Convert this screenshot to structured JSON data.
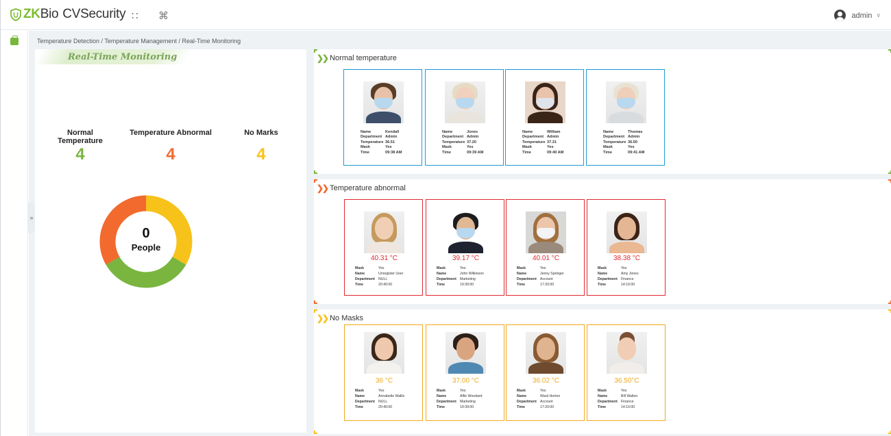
{
  "app": {
    "logo_zk": "ZK",
    "logo_bio": "Bio",
    "logo_product": "CVSecurity",
    "user": "admin",
    "grid_icon": "apps-grid-icon",
    "command_icon": "command-icon"
  },
  "breadcrumb": "Temperature Detection / Temperature Management / Real-Time Monitoring",
  "left": {
    "title": "Real-Time Monitoring",
    "stats": [
      {
        "label": "Normal Temperature",
        "value": "4",
        "color": "#7ab540"
      },
      {
        "label": "Temperature Abnormal",
        "value": "4",
        "color": "#f26a2e"
      },
      {
        "label": "No Marks",
        "value": "4",
        "color": "#f7c21a"
      }
    ],
    "donut": {
      "count": "0",
      "unit": "People",
      "segments": [
        {
          "name": "normal",
          "fraction": 0.3333,
          "color": "#7ab540"
        },
        {
          "name": "abnormal",
          "fraction": 0.3333,
          "color": "#f26a2e"
        },
        {
          "name": "nomask",
          "fraction": 0.3334,
          "color": "#f7c21a"
        }
      ]
    }
  },
  "sections": {
    "normal": {
      "title": "Normal temperature",
      "color": "#1c9bd6",
      "chevron_color": "#7ab540",
      "field_labels": {
        "name": "Name",
        "department": "Department",
        "temperature": "Temperature",
        "mask": "Mask",
        "time": "Time"
      },
      "cards": [
        {
          "name": "Kendall",
          "department": "Admin",
          "temperature": "36.51",
          "mask": "Yes",
          "time": "09:38 AM"
        },
        {
          "name": "Jones",
          "department": "Admin",
          "temperature": "37.20",
          "mask": "Yes",
          "time": "09:39 AM"
        },
        {
          "name": "William",
          "department": "Admin",
          "temperature": "37.31",
          "mask": "Yes",
          "time": "09:40 AM"
        },
        {
          "name": "Thomas",
          "department": "Admin",
          "temperature": "36.50",
          "mask": "Yes",
          "time": "09:41 AM"
        }
      ]
    },
    "abnormal": {
      "title": "Temperature abnormal",
      "color": "#e0282e",
      "chevron_color": "#f26a2e",
      "field_labels": {
        "mask": "Mask",
        "name": "Name",
        "department": "Department",
        "time": "Time"
      },
      "cards": [
        {
          "temp": "40.31 °C",
          "mask": "Yes",
          "name": "Unregister User",
          "department": "NULL",
          "time": "20:40:00"
        },
        {
          "temp": "39.17 °C",
          "mask": "Yes",
          "name": "John Wilkinson",
          "department": "Marketing",
          "time": "19:39:00"
        },
        {
          "temp": "40.01 °C",
          "mask": "Yes",
          "name": "Jenny Springer",
          "department": "Account",
          "time": "17:20:00"
        },
        {
          "temp": "38.38 °C",
          "mask": "Yes",
          "name": "Amy Jones",
          "department": "Finance",
          "time": "14:10:00"
        }
      ]
    },
    "nomask": {
      "title": "No Masks",
      "color": "#f0a81c",
      "chevron_color": "#f7c21a",
      "field_labels": {
        "mask": "Mask",
        "name": "Name",
        "department": "Department",
        "time": "Time"
      },
      "cards": [
        {
          "temp": "36 °C",
          "mask": "Yes",
          "name": "Annabelle Wallis",
          "department": "NULL",
          "time": "20:40:00"
        },
        {
          "temp": "37.00 °C",
          "mask": "Yes",
          "name": "Alfie Woodard",
          "department": "Marketing",
          "time": "19:39:00"
        },
        {
          "temp": "36.02 °C",
          "mask": "Yes",
          "name": "Ward Horton",
          "department": "Account",
          "time": "17:20:00"
        },
        {
          "temp": "36.50°C",
          "mask": "Yes",
          "name": "Bill Walton",
          "department": "Finance",
          "time": "14:10:00"
        }
      ]
    }
  }
}
